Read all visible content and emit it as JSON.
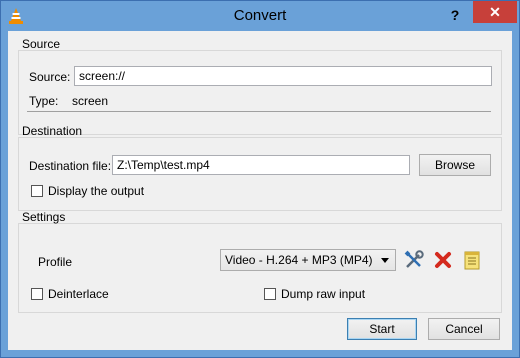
{
  "window": {
    "title": "Convert",
    "help_label": "?",
    "close_label": "✕"
  },
  "source_group": {
    "title": "Source",
    "source_label": "Source:",
    "source_value": "screen://",
    "type_label": "Type:",
    "type_value": "screen"
  },
  "destination_group": {
    "title": "Destination",
    "file_label": "Destination file:",
    "file_value": "Z:\\Temp\\test.mp4",
    "browse_label": "Browse",
    "display_output_label": "Display the output",
    "display_output_checked": false
  },
  "settings_group": {
    "title": "Settings",
    "profile_label": "Profile",
    "profile_selected": "Video - H.264 + MP3 (MP4)",
    "edit_profile_icon": "wrench-screwdriver-icon",
    "delete_profile_icon": "red-x-icon",
    "new_profile_icon": "notepad-icon",
    "deinterlace_label": "Deinterlace",
    "deinterlace_checked": false,
    "dump_raw_label": "Dump raw input",
    "dump_raw_checked": false
  },
  "footer": {
    "start_label": "Start",
    "cancel_label": "Cancel"
  },
  "colors": {
    "titlebar": "#6aa1d8",
    "close": "#c7403a",
    "client": "#f0f0f0",
    "vlc_orange": "#f08c00"
  }
}
